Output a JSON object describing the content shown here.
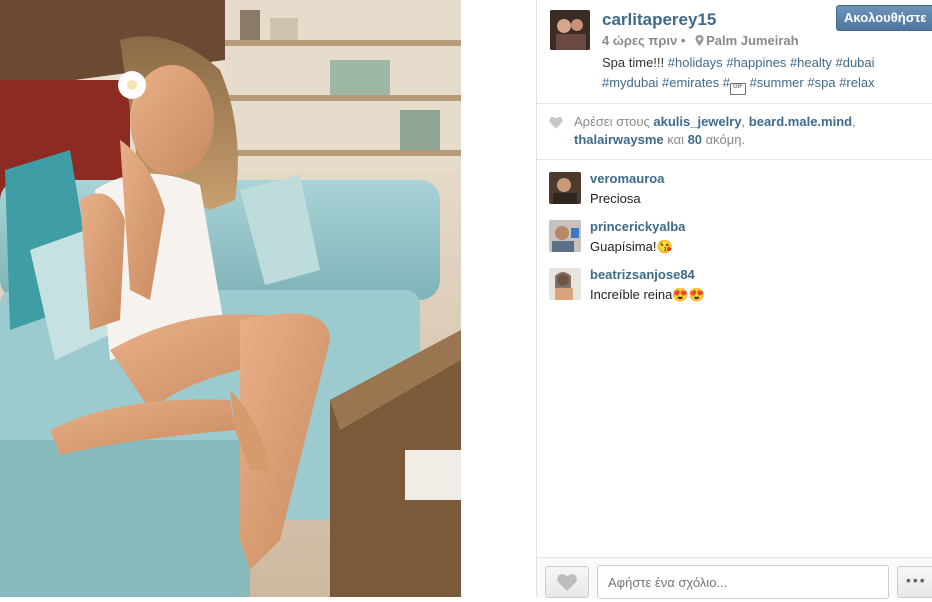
{
  "post": {
    "owner": {
      "username": "carlitaperey15"
    },
    "follow_label": "Ακολουθήστε",
    "time_ago": "4 ώρες πριν",
    "location": "Palm Jumeirah",
    "caption": {
      "text_start": "Spa time!!! ",
      "hashtags_line1": [
        "#holidays",
        "#happines",
        "#healty",
        "#dubai"
      ],
      "hashtags_line2a": [
        "#mydubai",
        "#emirates",
        "#"
      ],
      "emoji_label": "GIF",
      "hashtags_line2b": [
        "#summer",
        "#spa",
        "#relax"
      ]
    }
  },
  "likes": {
    "prefix": "Αρέσει στους ",
    "users": [
      "akulis_jewelry",
      "beard.male.mind",
      "thalairwaysme"
    ],
    "sep1": ", ",
    "sep2": ",",
    "and": " και ",
    "count": "80",
    "suffix": " ακόμη."
  },
  "comments": [
    {
      "user": "veromauroa",
      "text": "Preciosa"
    },
    {
      "user": "princerickyalba",
      "text": "Guapísima!😘"
    },
    {
      "user": "beatrizsanjose84",
      "text": "Increíble reina😍😍"
    }
  ],
  "footer": {
    "comment_placeholder": "Αφήστε ένα σχόλιο...",
    "more_label": "•••"
  },
  "colors": {
    "link": "#3f6a8c",
    "follow_bg": "#5a82aa",
    "muted": "#8a8a8a"
  },
  "icons": {
    "like": "heart-icon",
    "location": "pin-icon",
    "more": "ellipsis-icon"
  }
}
